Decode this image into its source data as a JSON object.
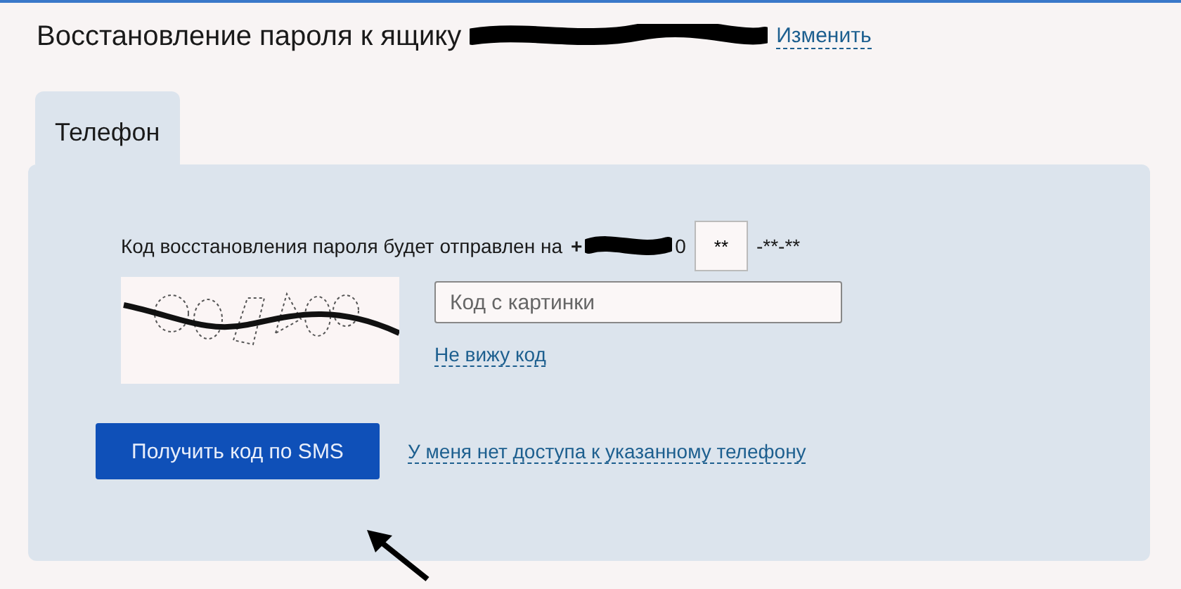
{
  "heading": {
    "text": "Восстановление пароля к ящику",
    "change_link": "Изменить"
  },
  "tabs": [
    {
      "label": "Телефон",
      "selected": true
    }
  ],
  "phone_line": {
    "text": "Код восстановления пароля будет отправлен на",
    "prefix": "+",
    "middle": "0",
    "field_value": "**",
    "suffix": "-**-**"
  },
  "captcha": {
    "kind": "picture",
    "placeholder": "Код с картинки",
    "refresh_link": "Не вижу код"
  },
  "submit_button": "Получить код по SMS",
  "no_access_link": "У меня нет доступа к указанному телефону"
}
